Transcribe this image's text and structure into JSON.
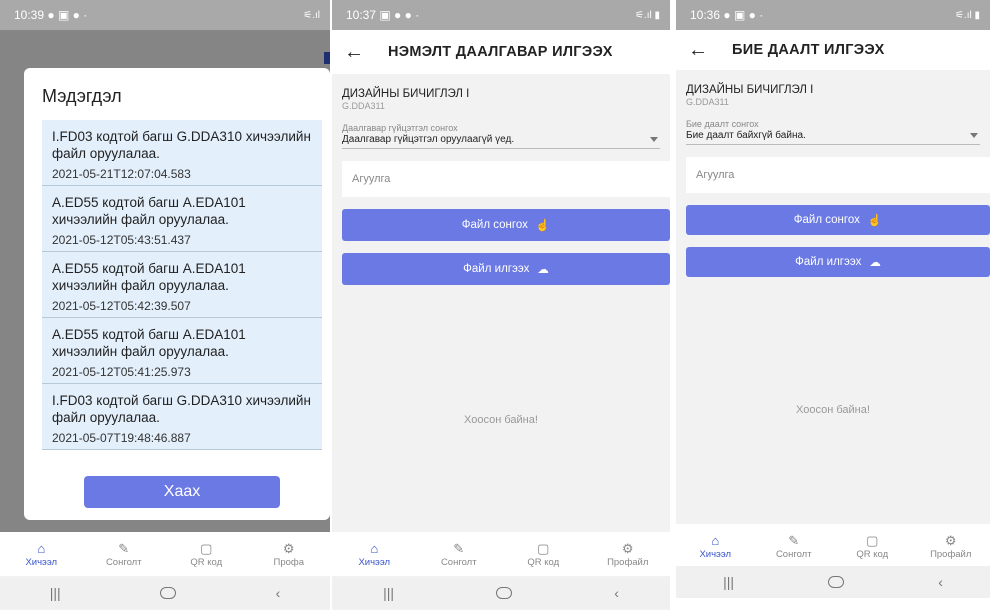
{
  "panel1": {
    "status": {
      "time": "10:39",
      "icons": "● ▣ ● ·",
      "right": "⚟.ıl"
    },
    "modal": {
      "title": "Мэдэгдэл",
      "notifications": [
        {
          "message": "I.FD03 кодтой багш G.DDA310 хичээлийн файл оруулалаа.",
          "time": "2021-05-21T12:07:04.583"
        },
        {
          "message": "A.ED55 кодтой багш A.EDA101 хичээлийн файл оруулалаа.",
          "time": "2021-05-12T05:43:51.437"
        },
        {
          "message": "A.ED55 кодтой багш A.EDA101 хичээлийн файл оруулалаа.",
          "time": "2021-05-12T05:42:39.507"
        },
        {
          "message": "A.ED55 кодтой багш A.EDA101 хичээлийн файл оруулалаа.",
          "time": "2021-05-12T05:41:25.973"
        },
        {
          "message": "I.FD03 кодтой багш G.DDA310 хичээлийн файл оруулалаа.",
          "time": "2021-05-07T19:48:46.887"
        }
      ],
      "close_label": "Хаах"
    },
    "nav": [
      "Хичээл",
      "Сонголт",
      "QR код",
      "Профа"
    ]
  },
  "panel2": {
    "status": {
      "time": "10:37",
      "icons": "▣ ● ● ·",
      "right": "⚟.ıl ▮"
    },
    "title": "НЭМЭЛТ ДААЛГАВАР ИЛГЭЭХ",
    "course_name": "ДИЗАЙНЫ БИЧИГЛЭЛ I",
    "course_code": "G.DDA311",
    "select_label": "Даалгавар гүйцэтгэл сонгох",
    "select_value": "Даалгавар гүйцэтгэл оруулаагүй үед.",
    "content_placeholder": "Агуулга",
    "choose_file": "Файл сонгох",
    "send_file": "Файл илгээх",
    "empty": "Хоосон байна!",
    "nav": [
      "Хичээл",
      "Сонголт",
      "QR код",
      "Профайл"
    ]
  },
  "panel3": {
    "status": {
      "time": "10:36",
      "icons": "● ▣ ● ·",
      "right": "⚟.ıl ▮"
    },
    "title": "БИЕ ДААЛТ ИЛГЭЭХ",
    "course_name": "ДИЗАЙНЫ БИЧИГЛЭЛ I",
    "course_code": "G.DDA311",
    "select_label": "Бие даалт сонгох",
    "select_value": "Бие даалт байхгүй байна.",
    "content_placeholder": "Агуулга",
    "choose_file": "Файл сонгох",
    "send_file": "Файл илгээх",
    "empty": "Хоосон байна!",
    "nav": [
      "Хичээл",
      "Сонголт",
      "QR код",
      "Профайл"
    ]
  },
  "icons": {
    "home": "home-icon",
    "choice": "pencil-icon",
    "qr": "qr-code-icon",
    "profile": "gear-icon",
    "hand": "hand-pointer-icon",
    "cloud": "cloud-upload-icon",
    "back": "back-arrow-icon"
  },
  "colors": {
    "primary": "#6a79e3",
    "active_nav": "#3a55c8",
    "notif_bg": "#e3effb"
  }
}
